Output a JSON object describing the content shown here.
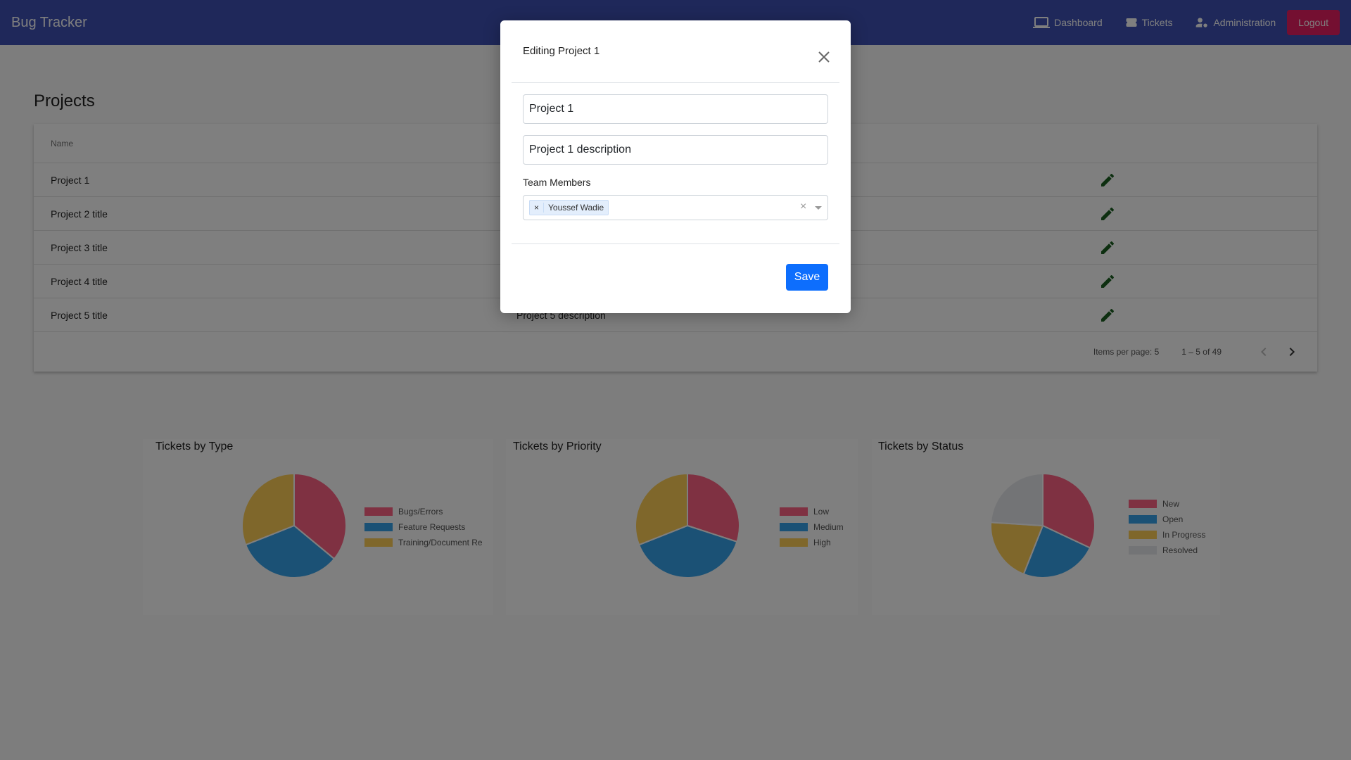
{
  "toolbar": {
    "brand": "Bug Tracker",
    "nav": [
      {
        "label": "Dashboard",
        "icon": "laptop-icon"
      },
      {
        "label": "Tickets",
        "icon": "ticket-icon"
      },
      {
        "label": "Administration",
        "icon": "admin-user-icon"
      }
    ],
    "logout_label": "Logout",
    "colors": {
      "bar": "#3f51b5",
      "logout": "#e91e63"
    }
  },
  "projects": {
    "title": "Projects",
    "columns": {
      "name": "Name"
    },
    "rows": [
      {
        "name": "Project 1",
        "description": ""
      },
      {
        "name": "Project 2 title",
        "description": ""
      },
      {
        "name": "Project 3 title",
        "description": ""
      },
      {
        "name": "Project 4 title",
        "description": ""
      },
      {
        "name": "Project 5 title",
        "description": "Project 5 description"
      }
    ],
    "paginator": {
      "items_per_page": "Items per page:  5",
      "range": "1 – 5 of 49"
    }
  },
  "charts": {
    "type": {
      "title": "Tickets by Type",
      "legend": [
        "Bugs/Errors",
        "Feature Requests",
        "Training/Document Re"
      ]
    },
    "priority": {
      "title": "Tickets by Priority",
      "legend": [
        "Low",
        "Medium",
        "High"
      ]
    },
    "status": {
      "title": "Tickets by Status",
      "legend": [
        "New",
        "Open",
        "In Progress",
        "Resolved"
      ]
    }
  },
  "chart_data": [
    {
      "type": "pie",
      "title": "Tickets by Type",
      "categories": [
        "Bugs/Errors",
        "Feature Requests",
        "Training/Document Re"
      ],
      "values": [
        36,
        33,
        31
      ],
      "colors": [
        "#ff6384",
        "#36a2eb",
        "#ffce56"
      ]
    },
    {
      "type": "pie",
      "title": "Tickets by Priority",
      "categories": [
        "Low",
        "Medium",
        "High"
      ],
      "values": [
        30,
        39,
        31
      ],
      "colors": [
        "#ff6384",
        "#36a2eb",
        "#ffce56"
      ]
    },
    {
      "type": "pie",
      "title": "Tickets by Status",
      "categories": [
        "New",
        "Open",
        "In Progress",
        "Resolved"
      ],
      "values": [
        32,
        24,
        20,
        24
      ],
      "colors": [
        "#ff6384",
        "#36a2eb",
        "#ffce56",
        "#e7e9ed"
      ]
    }
  ],
  "dialog": {
    "title": "Editing Project 1",
    "name_value": "Project 1",
    "description_value": "Project 1 description",
    "team_label": "Team Members",
    "team_members": [
      "Youssef Wadie"
    ],
    "save_label": "Save",
    "accent": "#0d6efd"
  }
}
